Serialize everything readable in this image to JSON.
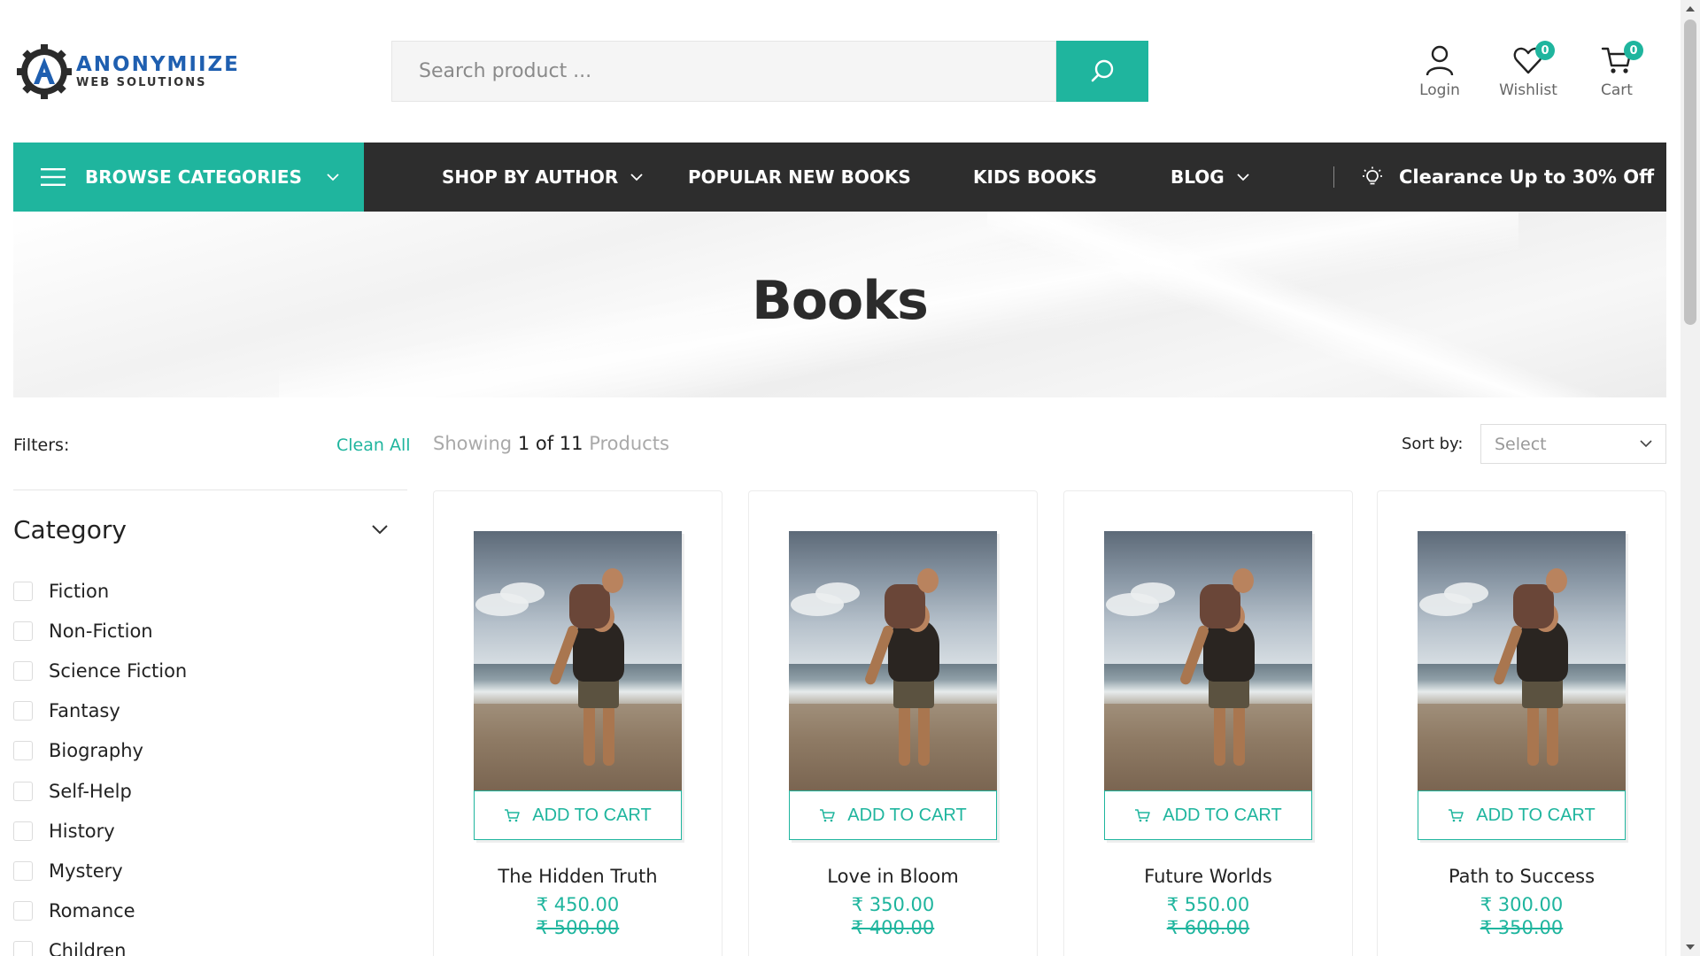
{
  "header": {
    "logo_title": "ANONYMIIZE",
    "logo_sub": "WEB SOLUTIONS",
    "search_placeholder": "Search product ...",
    "login_label": "Login",
    "wishlist_label": "Wishlist",
    "wishlist_count": "0",
    "cart_label": "Cart",
    "cart_count": "0"
  },
  "nav": {
    "browse_label": "BROWSE CATEGORIES",
    "links": [
      {
        "label": "SHOP BY AUTHOR"
      },
      {
        "label": "POPULAR NEW BOOKS"
      },
      {
        "label": "KIDS BOOKS"
      },
      {
        "label": "BLOG"
      }
    ],
    "clearance_label": "Clearance Up to 30% Off"
  },
  "hero": {
    "title": "Books"
  },
  "toolbar": {
    "filters_label": "Filters:",
    "clean_all_label": "Clean All",
    "showing_prefix": "Showing",
    "showing_count": "1 of 11",
    "showing_suffix": "Products",
    "sort_label": "Sort by:",
    "sort_value": "Select"
  },
  "sidebar": {
    "category_title": "Category",
    "categories": [
      {
        "label": "Fiction"
      },
      {
        "label": "Non-Fiction"
      },
      {
        "label": "Science Fiction"
      },
      {
        "label": "Fantasy"
      },
      {
        "label": "Biography"
      },
      {
        "label": "Self-Help"
      },
      {
        "label": "History"
      },
      {
        "label": "Mystery"
      },
      {
        "label": "Romance"
      },
      {
        "label": "Children"
      }
    ]
  },
  "products": [
    {
      "title": "The Hidden Truth",
      "price": "₹ 450.00",
      "old_price": "₹ 500.00",
      "cart_label": "ADD TO CART"
    },
    {
      "title": "Love in Bloom",
      "price": "₹ 350.00",
      "old_price": "₹ 400.00",
      "cart_label": "ADD TO CART"
    },
    {
      "title": "Future Worlds",
      "price": "₹ 550.00",
      "old_price": "₹ 600.00",
      "cart_label": "ADD TO CART"
    },
    {
      "title": "Path to Success",
      "price": "₹ 300.00",
      "old_price": "₹ 350.00",
      "cart_label": "ADD TO CART"
    }
  ],
  "colors": {
    "accent": "#1fb59e",
    "nav_bg": "#2d2d2d",
    "logo_blue": "#1f5fb0"
  }
}
